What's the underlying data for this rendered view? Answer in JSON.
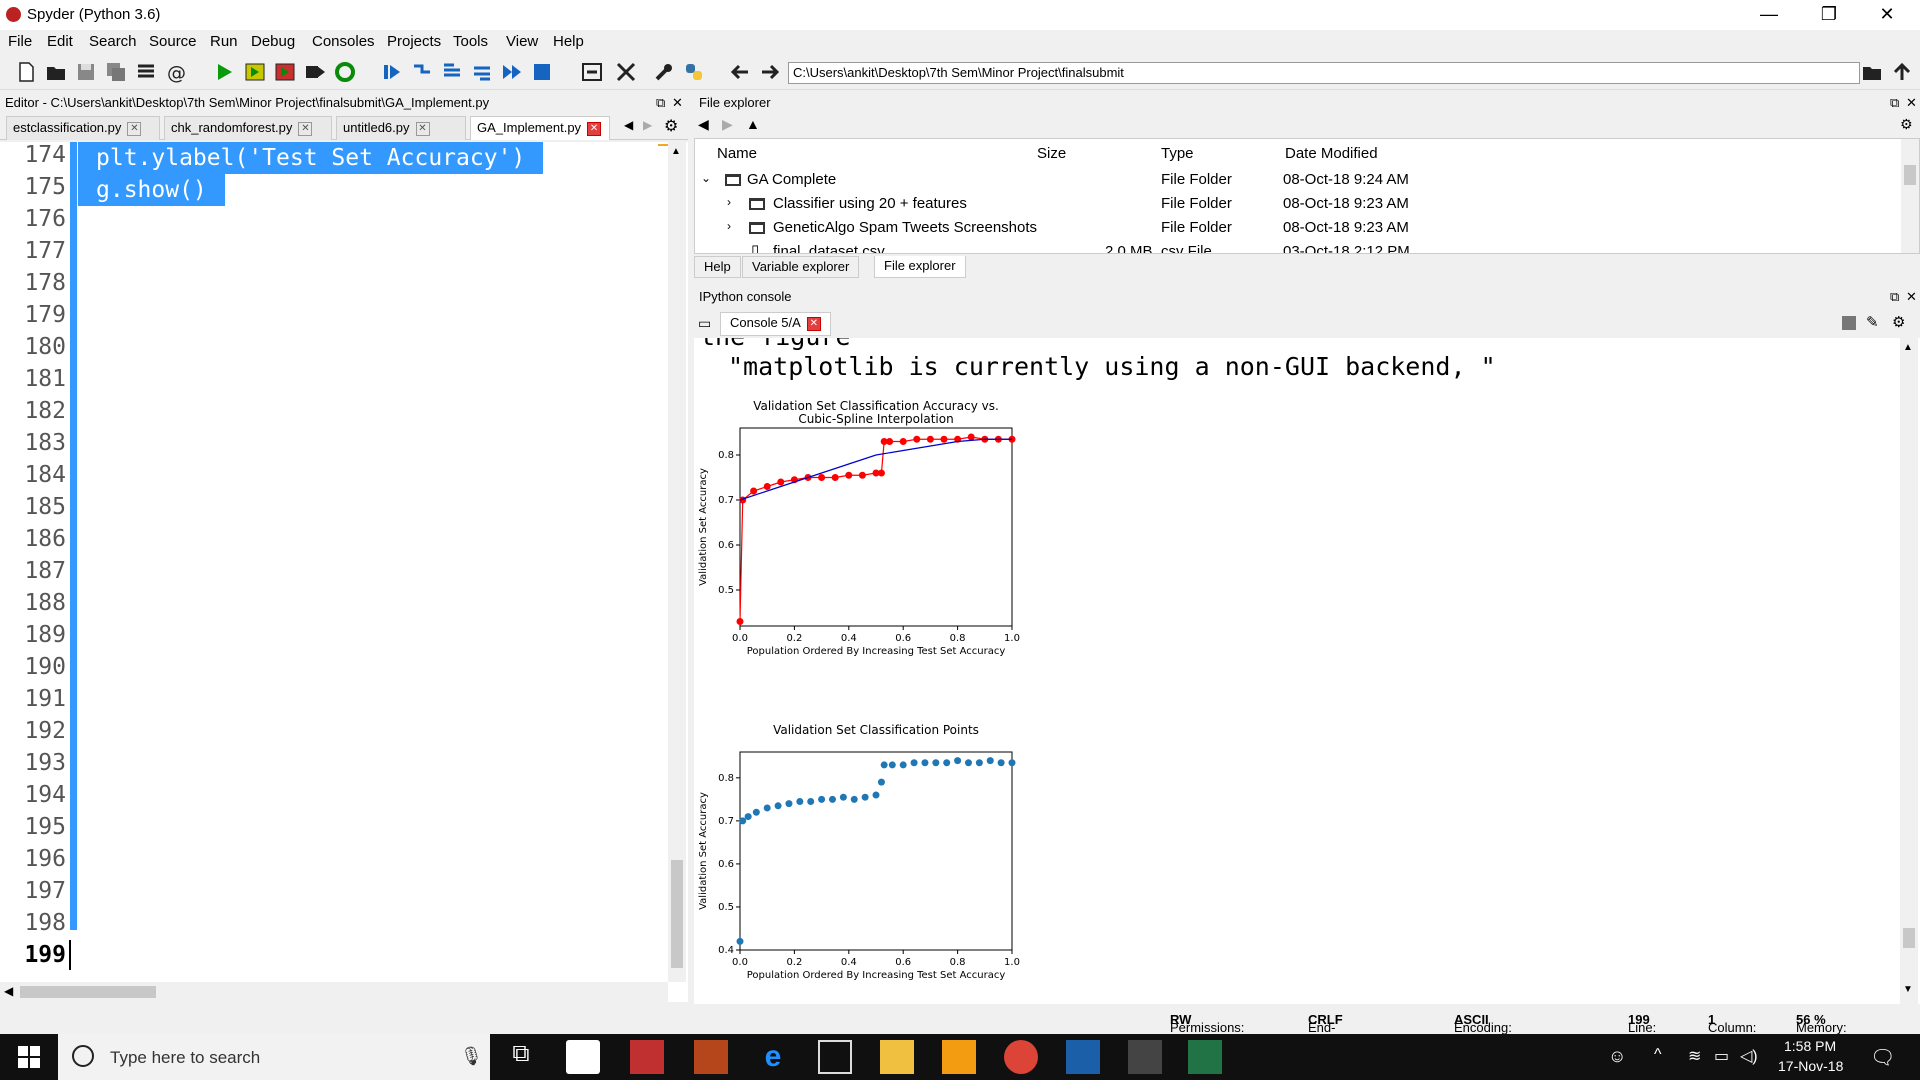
{
  "window": {
    "title": "Spyder (Python 3.6)",
    "minimize": "—",
    "maximize": "❐",
    "close": "✕"
  },
  "menu": [
    "File",
    "Edit",
    "Search",
    "Source",
    "Run",
    "Debug",
    "Consoles",
    "Projects",
    "Tools",
    "View",
    "Help"
  ],
  "toolbar": {
    "path": "C:\\Users\\ankit\\Desktop\\7th Sem\\Minor Project\\finalsubmit"
  },
  "editor": {
    "title": "Editor - C:\\Users\\ankit\\Desktop\\7th Sem\\Minor Project\\finalsubmit\\GA_Implement.py",
    "tabs": [
      {
        "label": "estclassification.py"
      },
      {
        "label": "chk_randomforest.py"
      },
      {
        "label": "untitled6.py"
      },
      {
        "label": "GA_Implement.py"
      }
    ],
    "line_numbers": [
      "174",
      "175",
      "176",
      "177",
      "178",
      "179",
      "180",
      "181",
      "182",
      "183",
      "184",
      "185",
      "186",
      "187",
      "188",
      "189",
      "190",
      "191",
      "192",
      "193",
      "194",
      "195",
      "196",
      "197",
      "198",
      "199"
    ],
    "code": [
      "plt.ylabel('Test Set Accuracy')",
      "g.show()"
    ]
  },
  "file_explorer": {
    "title": "File explorer",
    "columns": [
      "Name",
      "Size",
      "Type",
      "Date Modified"
    ],
    "rows": [
      {
        "name": "GA Complete",
        "size": "",
        "type": "File Folder",
        "date": "08-Oct-18 9:24 AM"
      },
      {
        "name": "Classifier using 20 + features",
        "size": "",
        "type": "File Folder",
        "date": "08-Oct-18 9:23 AM"
      },
      {
        "name": "GeneticAlgo Spam Tweets Screenshots",
        "size": "",
        "type": "File Folder",
        "date": "08-Oct-18 9:23 AM"
      },
      {
        "name": "final_dataset.csv",
        "size": "2.0 MB",
        "type": "csv File",
        "date": "03-Oct-18 2:12 PM"
      }
    ],
    "bottom_tabs": [
      "Help",
      "Variable explorer",
      "File explorer"
    ]
  },
  "ipython": {
    "title": "IPython console",
    "tab": "Console 5/A",
    "output_line_1": "the figure",
    "output_line_2": "\"matplotlib is currently using a non-GUI backend, \""
  },
  "chart_data": [
    {
      "type": "line",
      "title": "Validation Set Classification Accuracy vs.\nCubic-Spline Interpolation",
      "xlabel": "Population Ordered By Increasing Test Set Accuracy",
      "ylabel": "Validation Set Accuracy",
      "xlim": [
        0.0,
        1.0
      ],
      "ylim": [
        0.42,
        0.86
      ],
      "xticks": [
        "0.0",
        "0.2",
        "0.4",
        "0.6",
        "0.8",
        "1.0"
      ],
      "yticks": [
        "0.5",
        "0.6",
        "0.7",
        "0.8"
      ],
      "series": [
        {
          "color": "#ff0000",
          "x": [
            0.0,
            0.01,
            0.05,
            0.1,
            0.15,
            0.2,
            0.25,
            0.3,
            0.35,
            0.4,
            0.45,
            0.5,
            0.52,
            0.53,
            0.55,
            0.6,
            0.65,
            0.7,
            0.75,
            0.8,
            0.85,
            0.9,
            0.95,
            1.0
          ],
          "y": [
            0.43,
            0.7,
            0.72,
            0.73,
            0.74,
            0.745,
            0.75,
            0.75,
            0.75,
            0.755,
            0.755,
            0.76,
            0.76,
            0.83,
            0.83,
            0.83,
            0.835,
            0.835,
            0.835,
            0.835,
            0.84,
            0.835,
            0.835,
            0.835
          ]
        },
        {
          "color": "#0000cc",
          "x": [
            0.0,
            0.1,
            0.2,
            0.3,
            0.4,
            0.5,
            0.6,
            0.7,
            0.8,
            0.9,
            1.0
          ],
          "y": [
            0.7,
            0.72,
            0.74,
            0.76,
            0.78,
            0.8,
            0.81,
            0.82,
            0.83,
            0.835,
            0.835
          ]
        }
      ]
    },
    {
      "type": "scatter",
      "title": "Validation Set Classification Points",
      "xlabel": "Population Ordered By Increasing Test Set Accuracy",
      "ylabel": "Validation Set Accuracy",
      "xlim": [
        0.0,
        1.0
      ],
      "ylim": [
        0.4,
        0.86
      ],
      "xticks": [
        "0.0",
        "0.2",
        "0.4",
        "0.6",
        "0.8",
        "1.0"
      ],
      "yticks": [
        "0.4",
        "0.5",
        "0.6",
        "0.7",
        "0.8"
      ],
      "series": [
        {
          "color": "#1f77b4",
          "x": [
            0.0,
            0.01,
            0.03,
            0.06,
            0.1,
            0.14,
            0.18,
            0.22,
            0.26,
            0.3,
            0.34,
            0.38,
            0.42,
            0.46,
            0.5,
            0.52,
            0.53,
            0.56,
            0.6,
            0.64,
            0.68,
            0.72,
            0.76,
            0.8,
            0.84,
            0.88,
            0.92,
            0.96,
            1.0
          ],
          "y": [
            0.42,
            0.7,
            0.71,
            0.72,
            0.73,
            0.735,
            0.74,
            0.745,
            0.745,
            0.75,
            0.75,
            0.755,
            0.75,
            0.755,
            0.76,
            0.79,
            0.83,
            0.83,
            0.83,
            0.835,
            0.835,
            0.835,
            0.835,
            0.84,
            0.835,
            0.835,
            0.84,
            0.835,
            0.835
          ]
        }
      ]
    }
  ],
  "statusbar": {
    "permissions_label": "Permissions:",
    "permissions": "RW",
    "eol_label": "End-of-lines:",
    "eol": "CRLF",
    "encoding_label": "Encoding:",
    "encoding": "ASCII",
    "line_label": "Line:",
    "line": "199",
    "column_label": "Column:",
    "column": "1",
    "memory_label": "Memory:",
    "memory": "56 %"
  },
  "taskbar": {
    "search_placeholder": "Type here to search",
    "time": "1:58 PM",
    "date": "17-Nov-18"
  }
}
